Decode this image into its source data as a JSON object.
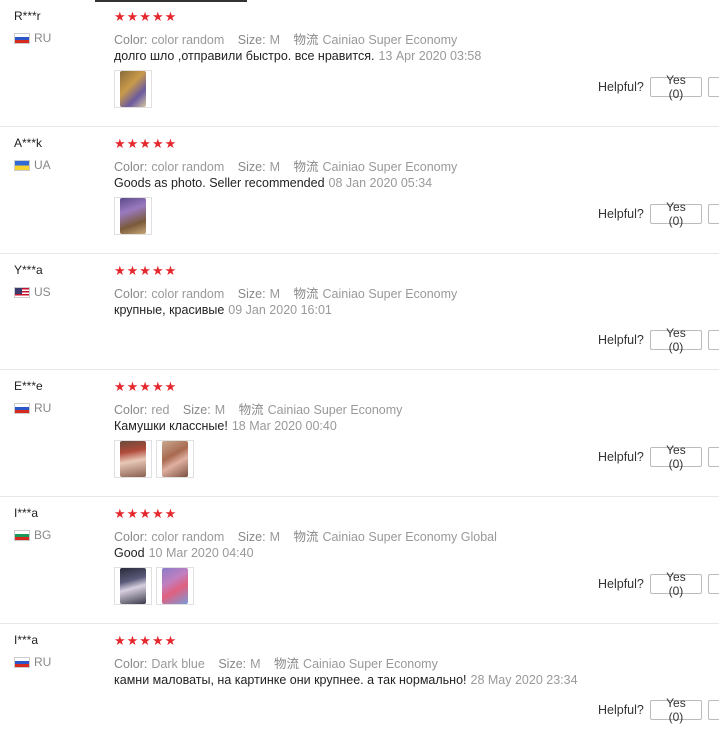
{
  "labels": {
    "color": "Color:",
    "size": "Size:",
    "shipping": "物流",
    "helpful": "Helpful?"
  },
  "reviews": [
    {
      "name": "R***r",
      "country": "RU",
      "stars": "★★★★★",
      "color": "color random",
      "size": "M",
      "shipping": "Cainiao Super Economy",
      "text": "долго шло ,отправили быстро. все нравится.",
      "date": "13 Apr 2020 03:58",
      "yes": "Yes (0)"
    },
    {
      "name": "A***k",
      "country": "UA",
      "stars": "★★★★★",
      "color": "color random",
      "size": "M",
      "shipping": "Cainiao Super Economy",
      "text": "Goods as photo. Seller recommended",
      "date": "08 Jan 2020 05:34",
      "yes": "Yes (0)"
    },
    {
      "name": "Y***a",
      "country": "US",
      "stars": "★★★★★",
      "color": "color random",
      "size": "M",
      "shipping": "Cainiao Super Economy",
      "text": "крупные, красивые",
      "date": "09 Jan 2020 16:01",
      "yes": "Yes (0)"
    },
    {
      "name": "E***e",
      "country": "RU",
      "stars": "★★★★★",
      "color": "red",
      "size": "M",
      "shipping": "Cainiao Super Economy",
      "text": "Камушки классные!",
      "date": "18 Mar 2020 00:40",
      "yes": "Yes (0)"
    },
    {
      "name": "I***a",
      "country": "BG",
      "stars": "★★★★★",
      "color": "color random",
      "size": "M",
      "shipping": "Cainiao Super Economy Global",
      "text": "Good",
      "date": "10 Mar 2020 04:40",
      "yes": "Yes (0)"
    },
    {
      "name": "I***a",
      "country": "RU",
      "stars": "★★★★★",
      "color": "Dark blue",
      "size": "M",
      "shipping": "Cainiao Super Economy",
      "text": "камни маловаты, на картинке они крупнее. а так нормально!",
      "date": "28 May 2020 23:34",
      "yes": "Yes (0)"
    }
  ]
}
